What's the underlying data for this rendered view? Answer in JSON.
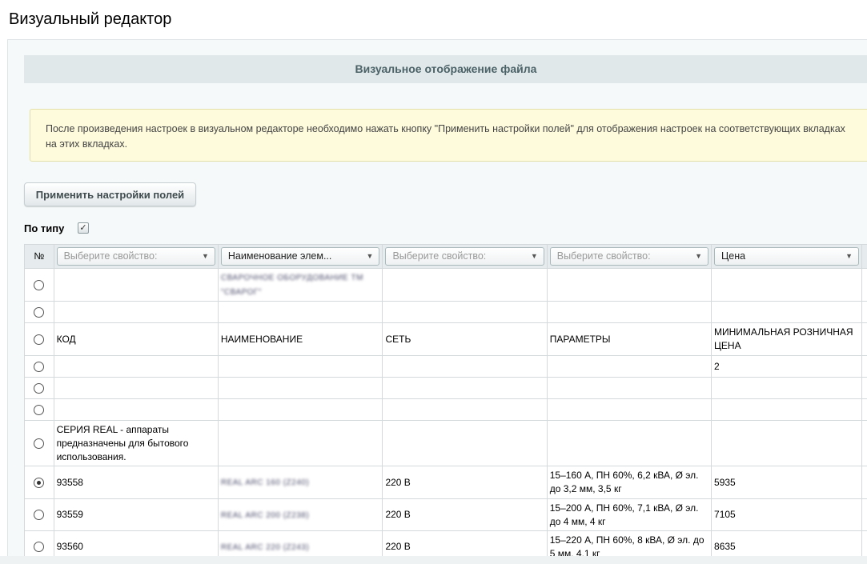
{
  "page": {
    "title": "Визуальный редактор"
  },
  "section": {
    "header": "Визуальное отображение файла"
  },
  "notice": {
    "line1": "После произведения настроек в визуальном редакторе необходимо нажать кнопку \"Применить настройки полей\" для отображения настроек на соответствующих вкладках",
    "line2": "на этих вкладках."
  },
  "toolbar": {
    "apply_label": "Применить настройки полей"
  },
  "filter": {
    "by_type_label": "По типу",
    "by_type_checked": true
  },
  "table": {
    "num_header": "№",
    "column_selects": [
      {
        "value": "Выберите свойство:",
        "placeholder": true
      },
      {
        "value": "Наименование элем...",
        "placeholder": false
      },
      {
        "value": "Выберите свойство:",
        "placeholder": true
      },
      {
        "value": "Выберите свойство:",
        "placeholder": true
      },
      {
        "value": "Цена",
        "placeholder": false
      }
    ],
    "rows": [
      {
        "checked": false,
        "h": 41,
        "cells": [
          "",
          "СВАРОЧНОЕ ОБОРУДОВАНИЕ ТМ \"СВАРОГ\"",
          "",
          "",
          ""
        ],
        "blur": [
          1
        ]
      },
      {
        "checked": false,
        "h": 27,
        "cells": [
          "",
          "",
          "",
          "",
          ""
        ]
      },
      {
        "checked": false,
        "h": 41,
        "cells": [
          "КОД",
          "НАИМЕНОВАНИЕ",
          "СЕТЬ",
          "ПАРАМЕТРЫ",
          "МИНИМАЛЬНАЯ РОЗНИЧНАЯ ЦЕНА"
        ]
      },
      {
        "checked": false,
        "h": 27,
        "cells": [
          "",
          "",
          "",
          "",
          "2"
        ]
      },
      {
        "checked": false,
        "h": 27,
        "cells": [
          "",
          "",
          "",
          "",
          ""
        ]
      },
      {
        "checked": false,
        "h": 27,
        "cells": [
          "",
          "",
          "",
          "",
          ""
        ]
      },
      {
        "checked": false,
        "h": 57,
        "cells": [
          "СЕРИЯ REAL - аппараты предназначены для бытового использования.",
          "",
          "",
          "",
          ""
        ]
      },
      {
        "checked": true,
        "h": 41,
        "cells": [
          "93558",
          "REAL ARC 160 (Z240)",
          "220 В",
          "15–160 А, ПН 60%, 6,2 кВА, Ø эл. до 3,2 мм, 3,5 кг",
          "5935"
        ],
        "blur": [
          1
        ]
      },
      {
        "checked": false,
        "h": 40,
        "cells": [
          "93559",
          "REAL ARC 200 (Z238)",
          "220 В",
          "15–200 А, ПН 60%, 7,1 кВА, Ø эл. до 4 мм, 4 кг",
          "7105"
        ],
        "blur": [
          1
        ]
      },
      {
        "checked": false,
        "h": 40,
        "cells": [
          "93560",
          "REAL ARC 220 (Z243)",
          "220 В",
          "15–220 А, ПН 60%, 8 кВА, Ø эл. до 5 мм, 4,1 кг",
          "8635"
        ],
        "blur": [
          1
        ]
      }
    ]
  }
}
